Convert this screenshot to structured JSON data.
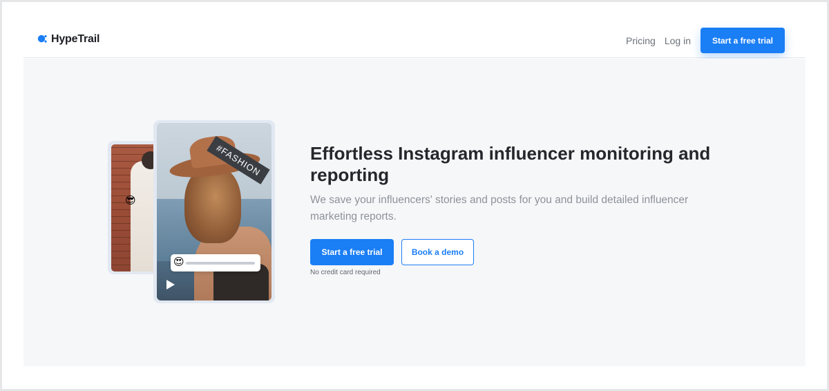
{
  "brand": {
    "name": "HypeTrail",
    "logo_icon": "hypetrail-logo-icon",
    "accent_color": "#1a7ef5"
  },
  "nav": {
    "links": [
      {
        "label": "Pricing"
      },
      {
        "label": "Log in"
      }
    ],
    "cta_label": "Start a free trial"
  },
  "hero": {
    "headline": "Effortless Instagram influencer monitoring and reporting",
    "subtext": "We save your influencers' stories and posts for you and build detailed influencer marketing reports.",
    "primary_cta": "Start a free trial",
    "secondary_cta": "Book a demo",
    "note": "No credit card required"
  },
  "visual": {
    "tag_text": "#FASHION",
    "back_card_emoji": "😎",
    "reaction_emoji": "😍",
    "play_icon": "play-icon"
  }
}
